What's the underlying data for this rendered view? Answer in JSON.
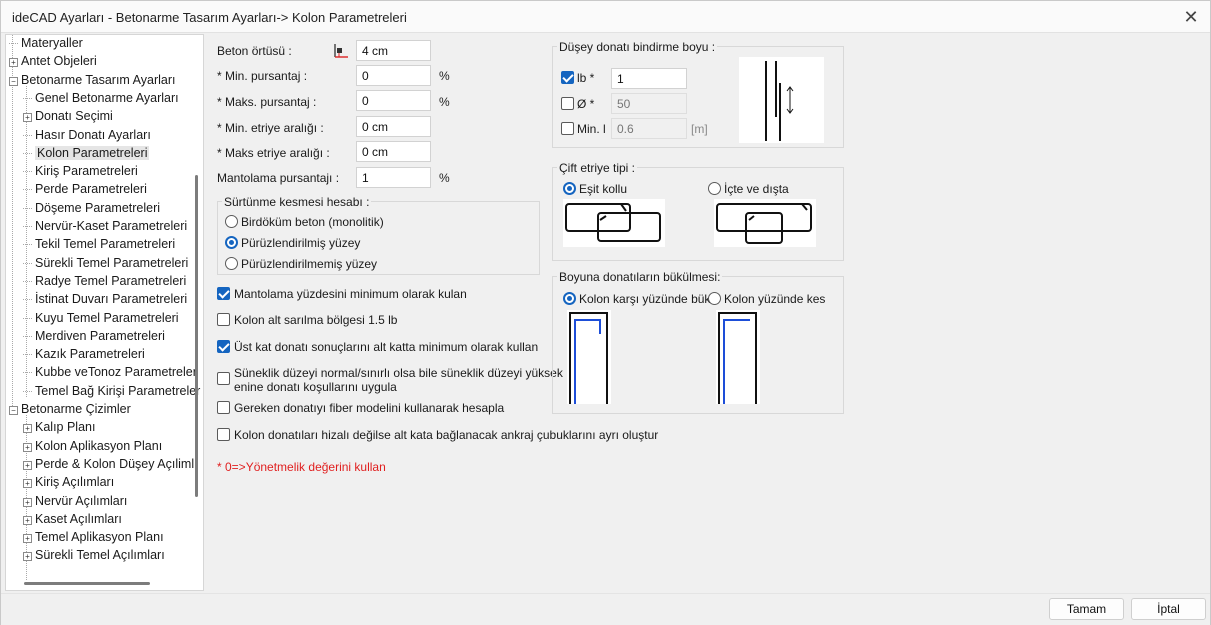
{
  "window": {
    "title": "ideCAD Ayarları - Betonarme Tasarım Ayarları-> Kolon Parametreleri",
    "close_glyph": "✕"
  },
  "tree": {
    "items": [
      {
        "label": "Materyaller",
        "level": 0,
        "expander": "",
        "selected": false
      },
      {
        "label": "Antet Objeleri",
        "level": 0,
        "expander": "+",
        "selected": false
      },
      {
        "label": "Betonarme Tasarım Ayarları",
        "level": 0,
        "expander": "−",
        "selected": false
      },
      {
        "label": "Genel Betonarme Ayarları",
        "level": 1,
        "expander": "",
        "selected": false
      },
      {
        "label": "Donatı Seçimi",
        "level": 1,
        "expander": "+",
        "selected": false
      },
      {
        "label": "Hasır Donatı Ayarları",
        "level": 1,
        "expander": "",
        "selected": false
      },
      {
        "label": "Kolon Parametreleri",
        "level": 1,
        "expander": "",
        "selected": true
      },
      {
        "label": "Kiriş Parametreleri",
        "level": 1,
        "expander": "",
        "selected": false
      },
      {
        "label": "Perde Parametreleri",
        "level": 1,
        "expander": "",
        "selected": false
      },
      {
        "label": "Döşeme Parametreleri",
        "level": 1,
        "expander": "",
        "selected": false
      },
      {
        "label": "Nervür-Kaset Parametreleri",
        "level": 1,
        "expander": "",
        "selected": false
      },
      {
        "label": "Tekil Temel Parametreleri",
        "level": 1,
        "expander": "",
        "selected": false
      },
      {
        "label": "Sürekli Temel Parametreleri",
        "level": 1,
        "expander": "",
        "selected": false
      },
      {
        "label": "Radye Temel Parametreleri",
        "level": 1,
        "expander": "",
        "selected": false
      },
      {
        "label": "İstinat Duvarı Parametreleri",
        "level": 1,
        "expander": "",
        "selected": false
      },
      {
        "label": "Kuyu Temel Parametreleri",
        "level": 1,
        "expander": "",
        "selected": false
      },
      {
        "label": "Merdiven Parametreleri",
        "level": 1,
        "expander": "",
        "selected": false
      },
      {
        "label": "Kazık Parametreleri",
        "level": 1,
        "expander": "",
        "selected": false
      },
      {
        "label": "Kubbe veTonoz Parametreler",
        "level": 1,
        "expander": "",
        "selected": false
      },
      {
        "label": "Temel Bağ Kirişi Parametreler",
        "level": 1,
        "expander": "",
        "selected": false
      },
      {
        "label": "Betonarme Çizimler",
        "level": 0,
        "expander": "−",
        "selected": false
      },
      {
        "label": "Kalıp Planı",
        "level": 1,
        "expander": "+",
        "selected": false
      },
      {
        "label": "Kolon Aplikasyon Planı",
        "level": 1,
        "expander": "+",
        "selected": false
      },
      {
        "label": "Perde & Kolon Düşey Açıliml",
        "level": 1,
        "expander": "+",
        "selected": false
      },
      {
        "label": "Kiriş Açılımları",
        "level": 1,
        "expander": "+",
        "selected": false
      },
      {
        "label": "Nervür Açılımları",
        "level": 1,
        "expander": "+",
        "selected": false
      },
      {
        "label": "Kaset Açılımları",
        "level": 1,
        "expander": "+",
        "selected": false
      },
      {
        "label": "Temel Aplikasyon Planı",
        "level": 1,
        "expander": "+",
        "selected": false
      },
      {
        "label": "Sürekli Temel Açılımları",
        "level": 1,
        "expander": "+",
        "selected": false
      }
    ]
  },
  "params": {
    "beton_ortusu": {
      "label": "Beton örtüsü :",
      "value": "4 cm",
      "icon": "cover-icon"
    },
    "min_pursantaj": {
      "label": "* Min.  pursantaj :",
      "value": "0",
      "unit": "%"
    },
    "maks_pursantaj": {
      "label": "* Maks. pursantaj :",
      "value": "0",
      "unit": "%"
    },
    "min_etriye": {
      "label": "* Min. etriye aralığı :",
      "value": "0 cm"
    },
    "maks_etriye": {
      "label": "* Maks etriye aralığı :",
      "value": "0 cm"
    },
    "mantolama": {
      "label": "Mantolama pursantajı :",
      "value": "1",
      "unit": "%"
    }
  },
  "surtunme": {
    "title": "Sürtünme kesmesi hesabı :",
    "options": [
      {
        "label": "Birdöküm beton (monolitik)",
        "checked": false
      },
      {
        "label": "Pürüzlendirilmiş yüzey",
        "checked": true
      },
      {
        "label": "Pürüzlendirilmemiş yüzey",
        "checked": false
      }
    ]
  },
  "checks": [
    {
      "label": "Mantolama yüzdesini minimum olarak kulan",
      "checked": true
    },
    {
      "label": "Kolon alt sarılma bölgesi 1.5 lb",
      "checked": false
    },
    {
      "label": "Üst kat donatı sonuçlarını alt katta minimum olarak kullan",
      "checked": true
    },
    {
      "label": "Süneklik düzeyi normal/sınırlı olsa bile süneklik düzeyi yüksek",
      "label2": "enine donatı koşullarını uygula",
      "checked": false
    },
    {
      "label": "Gereken donatıyı fiber modelini kullanarak hesapla",
      "checked": false
    },
    {
      "label": "Kolon donatıları hizalı değilse alt kata bağlanacak ankraj çubuklarını ayrı oluştur",
      "checked": false
    }
  ],
  "note": "* 0=>Yönetmelik değerini kullan",
  "bindirme": {
    "title": "Düşey donatı bindirme boyu :",
    "lb": {
      "label": "lb *",
      "value": "1",
      "checked": true
    },
    "phi": {
      "label": "Ø *",
      "value": "50",
      "checked": false
    },
    "min_l": {
      "label": "Min. l",
      "value": "0.6",
      "unit": "[m]",
      "checked": false
    }
  },
  "cift_etriye": {
    "title": "Çift etriye tipi :",
    "options": [
      {
        "label": "Eşit kollu",
        "checked": true
      },
      {
        "label": "İçte ve dışta",
        "checked": false
      }
    ]
  },
  "bukulme": {
    "title": "Boyuna donatıların bükülmesi:",
    "options": [
      {
        "label": "Kolon karşı yüzünde bük",
        "checked": true
      },
      {
        "label": "Kolon yüzünde kes",
        "checked": false
      }
    ]
  },
  "buttons": {
    "ok": "Tamam",
    "cancel": "İptal"
  },
  "colors": {
    "accent": "#1565c0",
    "note_red": "#e01f1f",
    "rebar_blue": "#1d4ed8"
  }
}
